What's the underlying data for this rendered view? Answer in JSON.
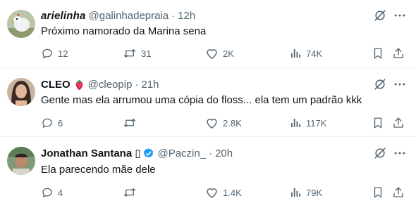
{
  "tweets": [
    {
      "display_name": "arielinha",
      "handle": "@galinhadepraia",
      "separator": "·",
      "time": "12h",
      "text": "Próximo namorado da Marina sena",
      "replies": "12",
      "retweets": "31",
      "likes": "2K",
      "views": "74K"
    },
    {
      "display_name": "CLEO",
      "handle": "@cleopip",
      "separator": "·",
      "time": "21h",
      "text": "Gente mas ela arrumou uma cópia do floss... ela tem um padrão kkk",
      "replies": "6",
      "retweets": "",
      "likes": "2.8K",
      "views": "117K"
    },
    {
      "display_name": "Jonathan Santana",
      "name_suffix": "▯",
      "handle": "@Paczin_",
      "separator": "·",
      "time": "20h",
      "text": "Ela parecendo mãe dele",
      "replies": "4",
      "retweets": "",
      "likes": "1.4K",
      "views": "79K"
    }
  ],
  "colors": {
    "text_primary": "#0f1419",
    "text_secondary": "#536471",
    "divider": "#eff3f4",
    "verified_blue": "#1d9bf0",
    "strawberry_red": "#e0245e"
  },
  "icons": [
    "grok-icon",
    "more-icon",
    "reply-icon",
    "retweet-icon",
    "like-icon",
    "views-icon",
    "bookmark-icon",
    "share-icon",
    "strawberry-emoji",
    "verified-badge-icon"
  ]
}
